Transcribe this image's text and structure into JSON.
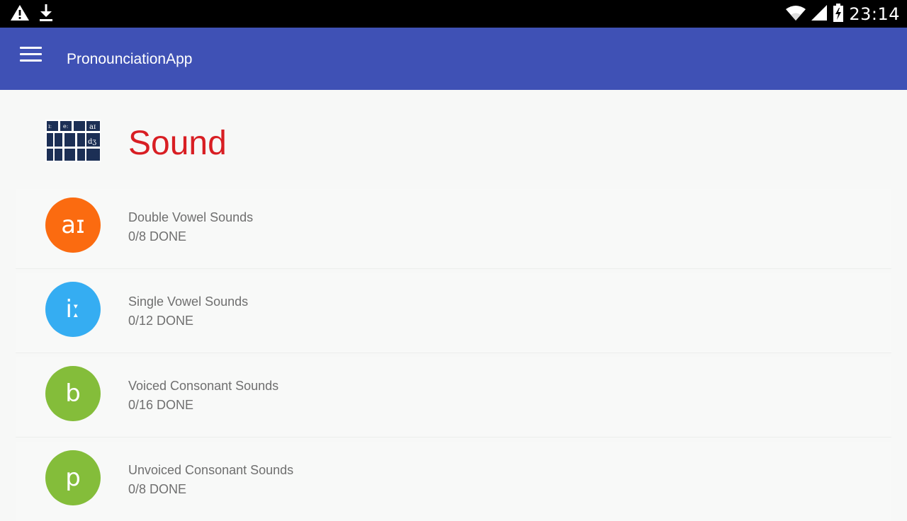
{
  "status_bar": {
    "time": "23:14",
    "icons": [
      "warning-icon",
      "download-icon",
      "wifi-icon",
      "signal-icon",
      "battery-icon"
    ]
  },
  "app_bar": {
    "title": "PronounciationApp",
    "color": "#3f51b5"
  },
  "section": {
    "title": "Sound",
    "title_color": "#d81e23"
  },
  "items": [
    {
      "symbol": "aɪ",
      "title": "Double Vowel Sounds",
      "progress": "0/8 DONE",
      "color": "#fb6b10"
    },
    {
      "symbol": "iː",
      "title": "Single Vowel Sounds",
      "progress": "0/12 DONE",
      "color": "#35adf2"
    },
    {
      "symbol": "b",
      "title": "Voiced Consonant Sounds",
      "progress": "0/16 DONE",
      "color": "#84bd3a"
    },
    {
      "symbol": "p",
      "title": "Unvoiced Consonant Sounds",
      "progress": "0/8 DONE",
      "color": "#84bd3a"
    }
  ]
}
